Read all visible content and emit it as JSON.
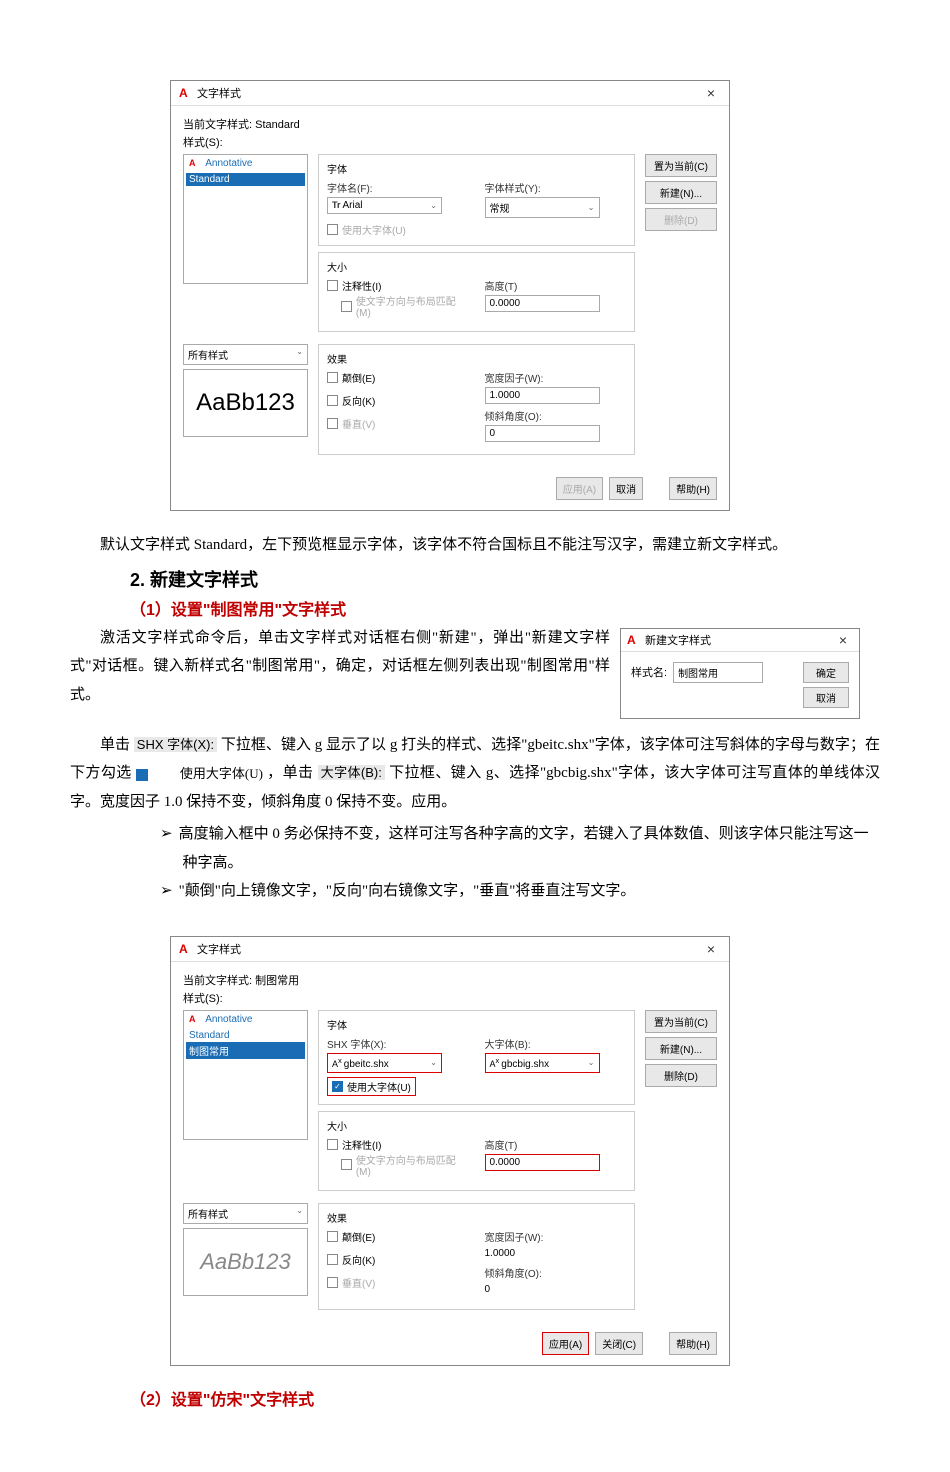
{
  "dialog1": {
    "title": "文字样式",
    "current_style_label": "当前文字样式:",
    "current_style_value": "Standard",
    "styles_label": "样式(S):",
    "styles_list": [
      {
        "name": "Annotative",
        "selected": false
      },
      {
        "name": "Standard",
        "selected": true
      }
    ],
    "font": {
      "group_label": "字体",
      "name_label": "字体名(F):",
      "name_value": "Arial",
      "style_label": "字体样式(Y):",
      "style_value": "常规",
      "bigfont_checkbox": "使用大字体(U)"
    },
    "size": {
      "group_label": "大小",
      "annotative_checkbox": "注释性(I)",
      "match_checkbox": "使文字方向与布局匹配(M)",
      "height_label": "高度(T)",
      "height_value": "0.0000"
    },
    "all_styles_label": "所有样式",
    "effects": {
      "group_label": "效果",
      "upside_checkbox": "颠倒(E)",
      "backwards_checkbox": "反向(K)",
      "vertical_checkbox": "垂直(V)",
      "width_label": "宽度因子(W):",
      "width_value": "1.0000",
      "oblique_label": "倾斜角度(O):",
      "oblique_value": "0"
    },
    "preview_text": "AaBb123",
    "btn_set_current": "置为当前(C)",
    "btn_new": "新建(N)...",
    "btn_delete": "删除(D)",
    "btn_apply": "应用(A)",
    "btn_cancel": "取消",
    "btn_help": "帮助(H)"
  },
  "para1": "默认文字样式 Standard，左下预览框显示字体，该字体不符合国标且不能注写汉字，需建立新文字样式。",
  "section2_title": "2. 新建文字样式",
  "sub1_title": "（1）设置\"制图常用\"文字样式",
  "small_dialog": {
    "title": "新建文字样式",
    "name_label": "样式名:",
    "name_value": "制图常用",
    "btn_ok": "确定",
    "btn_cancel": "取消"
  },
  "para2": "激活文字样式命令后，单击文字样式对话框右侧\"新建\"，弹出\"新建文字样式\"对话框。键入新样式名\"制图常用\"，确定，对话框左侧列表出现\"制图常用\"样式。",
  "para3_pre": "单击",
  "para3_snippet1": "SHX 字体(X):",
  "para3_mid1": "下拉框、键入 g 显示了以 g 打头的样式、选择\"gbeitc.shx\"字体，该字体可注写斜体的字母与数字；在下方勾选",
  "para3_snippet2": "使用大字体(U)",
  "para3_mid2": "，单击",
  "para3_snippet3": "大字体(B):",
  "para3_mid3": "下拉框、键入 g、选择\"gbcbig.shx\"字体，该大字体可注写直体的单线体汉字。宽度因子 1.0 保持不变，倾斜角度 0 保持不变。应用。",
  "bullet1": "高度输入框中 0 务必保持不变，这样可注写各种字高的文字，若键入了具体数值、则该字体只能注写这一种字高。",
  "bullet2": "\"颠倒\"向上镜像文字，\"反向\"向右镜像文字，\"垂直\"将垂直注写文字。",
  "dialog2": {
    "title": "文字样式",
    "current_style_label": "当前文字样式:",
    "current_style_value": "制图常用",
    "styles_label": "样式(S):",
    "styles_list": [
      {
        "name": "Annotative",
        "selected": false
      },
      {
        "name": "Standard",
        "selected": false
      },
      {
        "name": "制图常用",
        "selected": true
      }
    ],
    "font": {
      "group_label": "字体",
      "shx_label": "SHX 字体(X):",
      "shx_value": "gbeitc.shx",
      "bigfont_label": "大字体(B):",
      "bigfont_value": "gbcbig.shx",
      "bigfont_checkbox": "使用大字体(U)"
    },
    "size": {
      "group_label": "大小",
      "annotative_checkbox": "注释性(I)",
      "match_checkbox": "使文字方向与布局匹配(M)",
      "height_label": "高度(T)",
      "height_value": "0.0000"
    },
    "all_styles_label": "所有样式",
    "effects": {
      "group_label": "效果",
      "upside_checkbox": "颠倒(E)",
      "backwards_checkbox": "反向(K)",
      "vertical_checkbox": "垂直(V)",
      "width_label": "宽度因子(W):",
      "width_value": "1.0000",
      "oblique_label": "倾斜角度(O):",
      "oblique_value": "0"
    },
    "preview_text": "AaBb123",
    "btn_set_current": "置为当前(C)",
    "btn_new": "新建(N)...",
    "btn_delete": "删除(D)",
    "btn_apply": "应用(A)",
    "btn_close": "关闭(C)",
    "btn_help": "帮助(H)"
  },
  "sub2_title": "（2）设置\"仿宋\"文字样式"
}
